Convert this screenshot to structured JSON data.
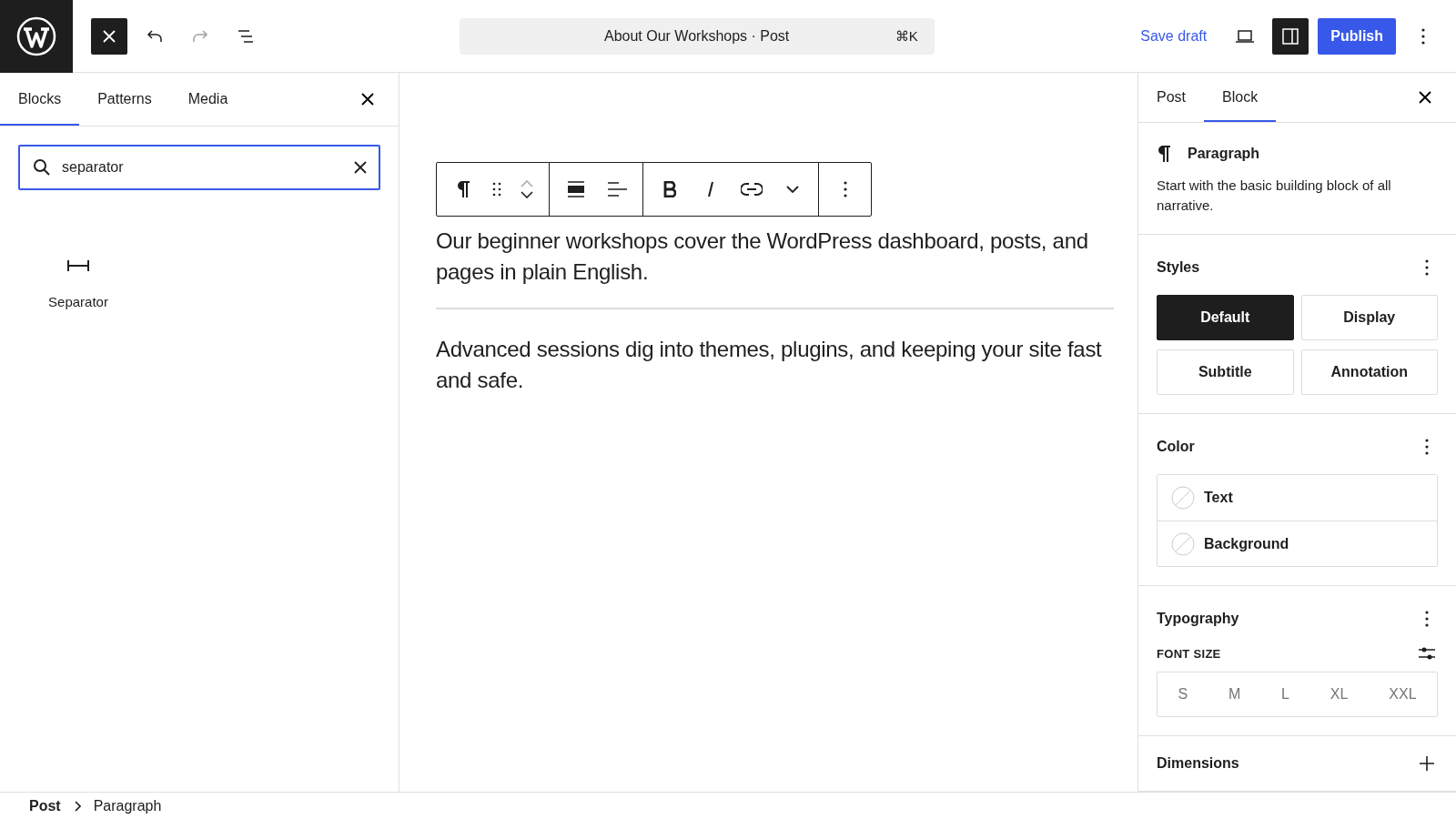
{
  "top_bar": {
    "document_title": "About Our Workshops · Post",
    "shortcut": "⌘K",
    "save_draft": "Save draft",
    "settings_toggle": {
      "selected": true
    },
    "publish": "Publish",
    "redo": {
      "disabled": true
    }
  },
  "inserter": {
    "tabs": [
      {
        "label": "Blocks",
        "selected": true
      },
      {
        "label": "Patterns",
        "selected": false
      },
      {
        "label": "Media",
        "selected": false
      }
    ],
    "search": {
      "value": "separator"
    },
    "results": [
      {
        "label": "Separator"
      }
    ]
  },
  "editor": {
    "blocks": [
      {
        "kind": "paragraph",
        "text": "Our beginner workshops cover the WordPress dashboard, posts, and pages in plain English."
      },
      {
        "kind": "separator"
      },
      {
        "kind": "paragraph",
        "text": "Advanced sessions dig into themes, plugins, and keeping your site fast and safe."
      }
    ]
  },
  "sidebar": {
    "tabs": [
      {
        "label": "Post",
        "selected": false
      },
      {
        "label": "Block",
        "selected": true
      }
    ],
    "block": {
      "name": "Paragraph",
      "description": "Start with the basic building block of all narrative."
    },
    "styles": {
      "title": "Styles",
      "options": [
        {
          "label": "Default",
          "selected": true
        },
        {
          "label": "Display",
          "selected": false
        },
        {
          "label": "Subtitle",
          "selected": false
        },
        {
          "label": "Annotation",
          "selected": false
        }
      ]
    },
    "color": {
      "title": "Color",
      "items": [
        "Text",
        "Background"
      ]
    },
    "typography": {
      "title": "Typography",
      "font_size_label": "FONT SIZE",
      "sizes": [
        "S",
        "M",
        "L",
        "XL",
        "XXL"
      ]
    },
    "dimensions": {
      "title": "Dimensions"
    }
  },
  "breadcrumb": [
    "Post",
    "Paragraph"
  ]
}
